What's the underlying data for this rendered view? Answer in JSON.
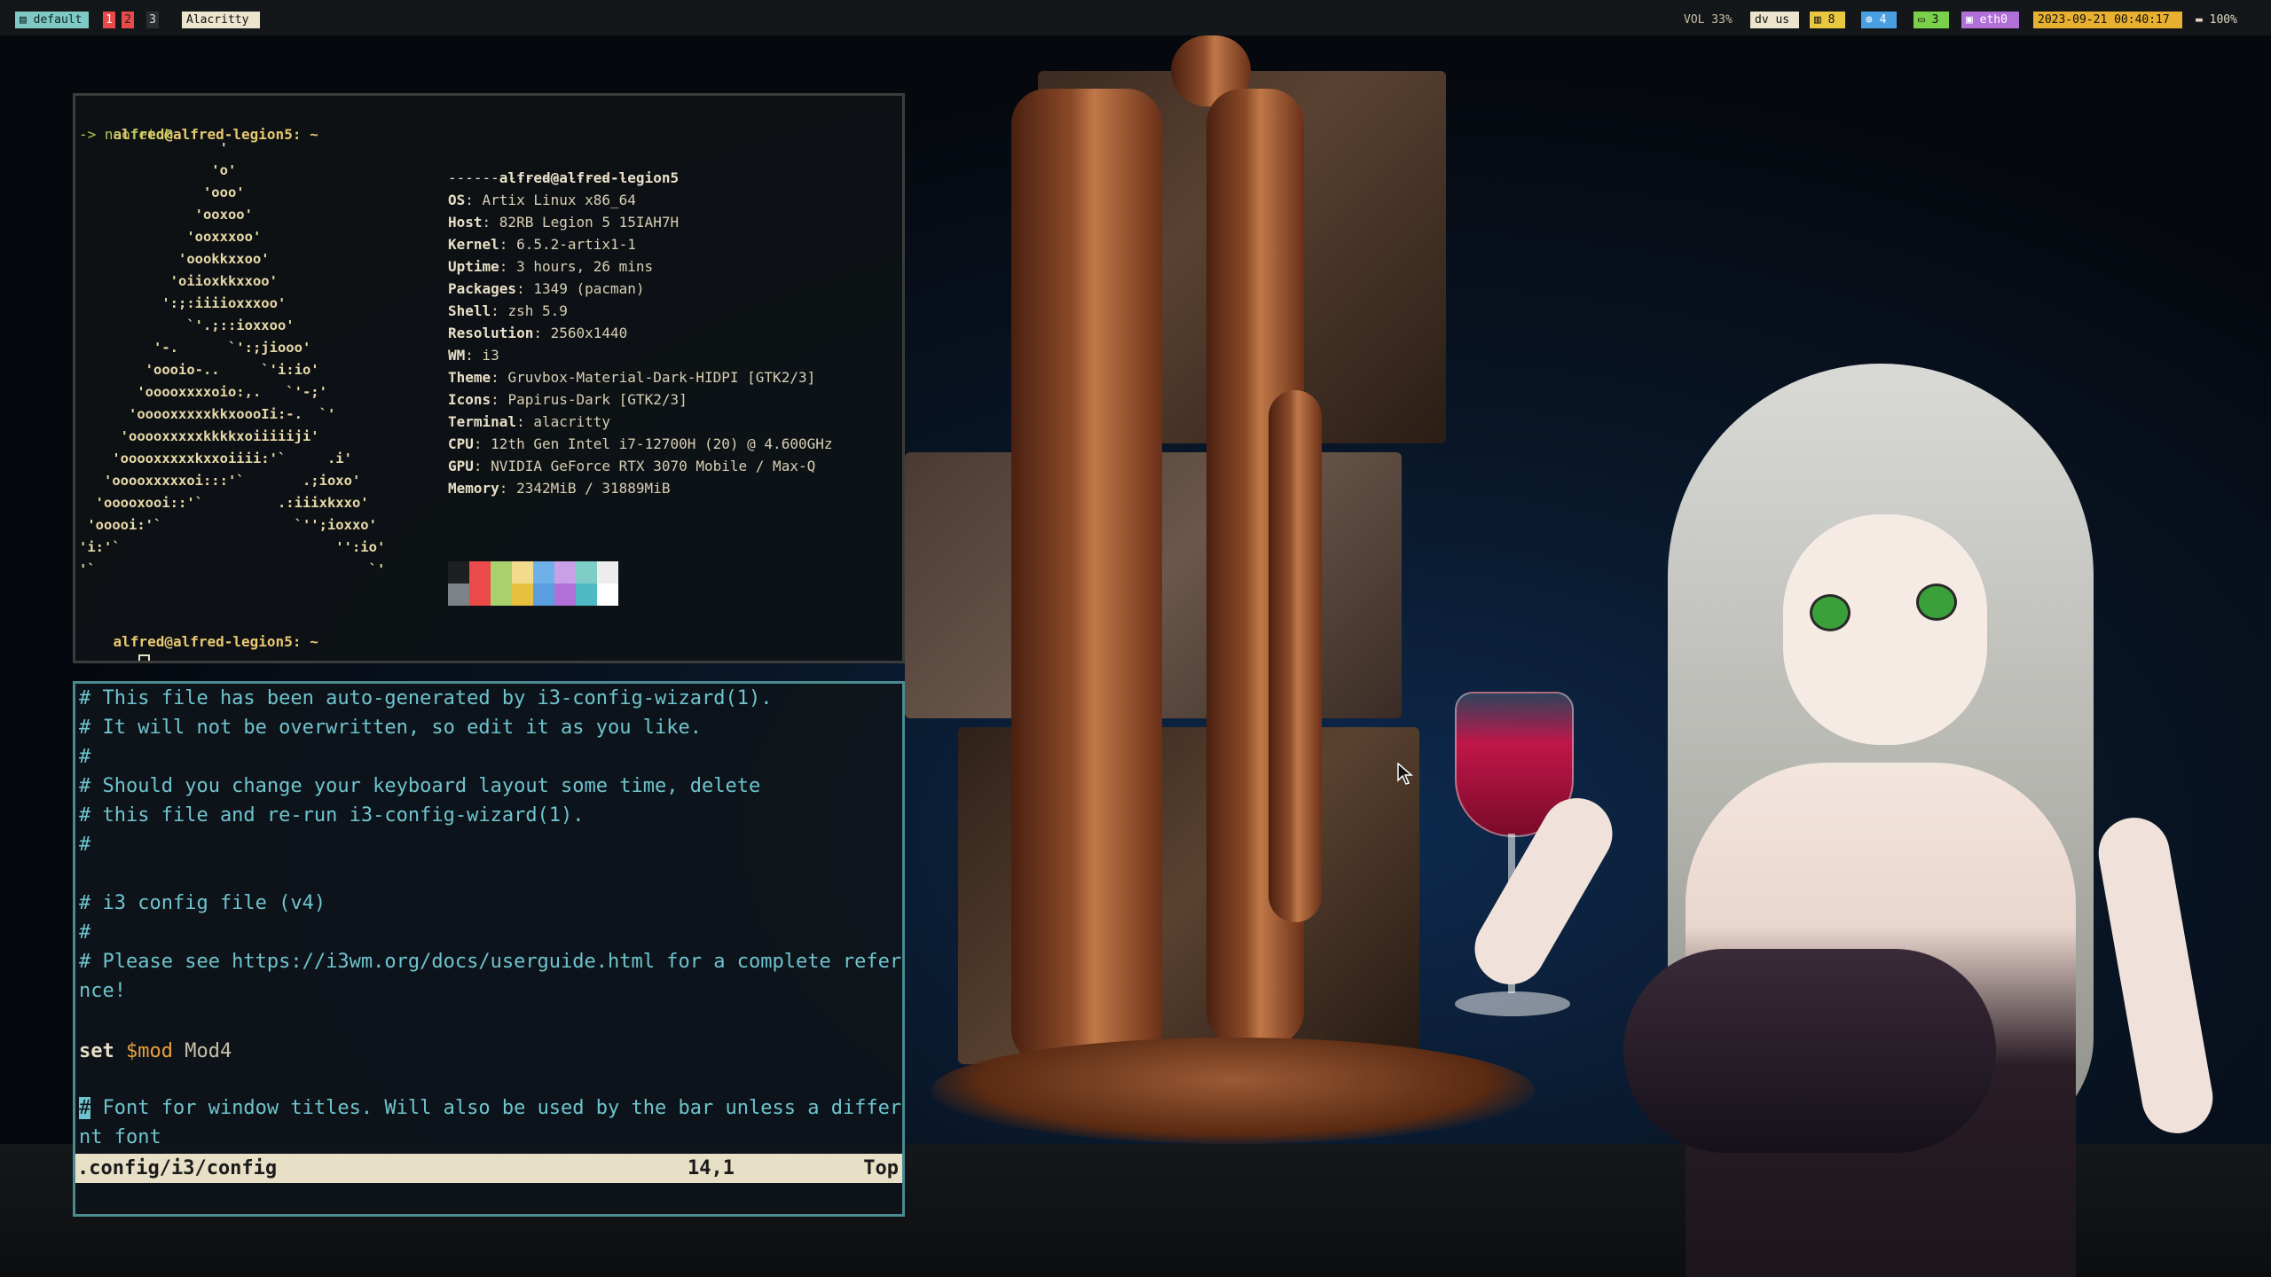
{
  "topbar": {
    "layout_label": "default",
    "workspaces": [
      "1",
      "2",
      "3"
    ],
    "active_window": "Alacritty",
    "volume": "VOL 33%",
    "keyboard": "dv us",
    "tray": [
      {
        "icon": "memory-icon",
        "value": "8"
      },
      {
        "icon": "cpu-icon",
        "value": "4"
      },
      {
        "icon": "display-icon",
        "value": "3"
      },
      {
        "icon": "network-icon",
        "value": "eth0"
      }
    ],
    "datetime": "2023-09-21 00:40:17",
    "battery": "100%"
  },
  "terminal": {
    "prompt_user": "alfred@alfred-legion5: ~",
    "command": "-> neofetch",
    "ascii_art": [
      "                 '",
      "                'o'",
      "               'ooo'",
      "              'ooxoo'",
      "             'ooxxxoo'",
      "            'oookkxxoo'",
      "           'oiioxkkxxoo'",
      "          ':;:iiiioxxxoo'",
      "             `'.;::ioxxoo'",
      "         '-.      `':;jiooo'",
      "        'oooio-..     `'i:io'",
      "       'ooooxxxxoio:,.   `'-;'",
      "      'ooooxxxxxkkxoooIi:-.  `'",
      "     'ooooxxxxxkkkkxoiiiiiji'",
      "    'ooooxxxxxkxxoiiii:'`     .i'",
      "   'ooooxxxxxoi:::'`       .;ioxo'",
      "  'ooooxooi::'`         .:iiixkxxo'",
      " 'ooooi:'`                `'';ioxxo'",
      "'i:'`                          '':io'",
      "'`                                 `'"
    ],
    "info_title": "alfred@alfred-legion5",
    "info_separator": "---------------------",
    "info": [
      {
        "k": "OS",
        "v": "Artix Linux x86_64"
      },
      {
        "k": "Host",
        "v": "82RB Legion 5 15IAH7H"
      },
      {
        "k": "Kernel",
        "v": "6.5.2-artix1-1"
      },
      {
        "k": "Uptime",
        "v": "3 hours, 26 mins"
      },
      {
        "k": "Packages",
        "v": "1349 (pacman)"
      },
      {
        "k": "Shell",
        "v": "zsh 5.9"
      },
      {
        "k": "Resolution",
        "v": "2560x1440"
      },
      {
        "k": "WM",
        "v": "i3"
      },
      {
        "k": "Theme",
        "v": "Gruvbox-Material-Dark-HIDPI [GTK2/3]"
      },
      {
        "k": "Icons",
        "v": "Papirus-Dark [GTK2/3]"
      },
      {
        "k": "Terminal",
        "v": "alacritty"
      },
      {
        "k": "CPU",
        "v": "12th Gen Intel i7-12700H (20) @ 4.600GHz"
      },
      {
        "k": "GPU",
        "v": "NVIDIA GeForce RTX 3070 Mobile / Max-Q"
      },
      {
        "k": "Memory",
        "v": "2342MiB / 31889MiB"
      }
    ],
    "palette_top": [
      "#1d2021",
      "#ea4a4a",
      "#a9d06a",
      "#f2dc8c",
      "#6fb0e8",
      "#c9a0e8",
      "#7ecec7",
      "#ededed"
    ],
    "palette_bottom": [
      "#7c8387",
      "#ea4a4a",
      "#a9d06a",
      "#e8c040",
      "#5a9ee0",
      "#b070d8",
      "#4fbac4",
      "#ffffff"
    ],
    "prompt2_user": "alfred@alfred-legion5: ~",
    "prompt2": "-> "
  },
  "vim": {
    "lines": [
      "# This file has been auto-generated by i3-config-wizard(1).",
      "# It will not be overwritten, so edit it as you like.",
      "#",
      "# Should you change your keyboard layout some time, delete",
      "# this file and re-run i3-config-wizard(1).",
      "#",
      "",
      "# i3 config file (v4)",
      "#",
      "# Please see https://i3wm.org/docs/userguide.html for a complete refere",
      "nce!",
      "",
      "",
      "",
      " Font for window titles. Will also be used by the bar unless a differe",
      "nt font"
    ],
    "set_keyword": "set",
    "set_var": "$mod",
    "set_value": "Mod4",
    "cursor_char": "#",
    "status_file": ".config/i3/config",
    "status_pos": "14,1",
    "status_scroll": "Top"
  }
}
